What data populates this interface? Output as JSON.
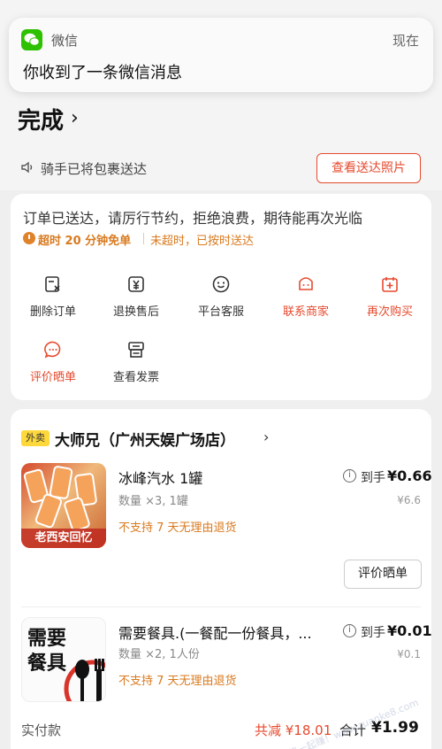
{
  "notification": {
    "app_name": "微信",
    "time": "现在",
    "message": "你收到了一条微信消息"
  },
  "status": {
    "title": "完成",
    "rider_text": "骑手已将包裹送达",
    "photo_button": "查看送达照片"
  },
  "order_info": {
    "delivered_message": "订单已送达，请厉行节约，拒绝浪费，期待能再次光临",
    "timeout_label": "超时 20 分钟免单",
    "ontime_label": "未超时，已按时送达"
  },
  "actions": [
    {
      "label": "删除订单",
      "icon": "delete-order-icon",
      "highlight": false
    },
    {
      "label": "退换售后",
      "icon": "refund-icon",
      "highlight": false
    },
    {
      "label": "平台客服",
      "icon": "customer-service-icon",
      "highlight": false
    },
    {
      "label": "联系商家",
      "icon": "store-contact-icon",
      "highlight": true
    },
    {
      "label": "再次购买",
      "icon": "rebuy-icon",
      "highlight": true
    },
    {
      "label": "评价晒单",
      "icon": "review-icon",
      "highlight": true
    },
    {
      "label": "查看发票",
      "icon": "invoice-icon",
      "highlight": false
    }
  ],
  "shop": {
    "tag": "外卖",
    "name": "大师兄（广州天娱广场店）"
  },
  "products": [
    {
      "name": "冰峰汽水 1罐",
      "qty": "数量 ×3, 1罐",
      "policy": "不支持 7 天无理由退货",
      "price_label": "到手",
      "price": "¥0.66",
      "original_price": "¥6.6",
      "image_caption": "老西安回忆",
      "review_button": "评价晒单"
    },
    {
      "name": "需要餐具.(一餐配一份餐具，...",
      "qty": "数量 ×2, 1人份",
      "policy": "不支持 7 天无理由退货",
      "price_label": "到手",
      "price": "¥0.01",
      "original_price": "¥0.1",
      "image_text": "需要\n餐具"
    }
  ],
  "summary": {
    "paid_label": "实付款",
    "discount": "共减 ¥18.01",
    "total_label": "合计",
    "total": "¥1.99"
  },
  "watermark": "赚客吧，有奖一起赚！www.zuanke8.com",
  "colors": {
    "accent": "#e64a2e",
    "orange": "#d87a1f",
    "wechat": "#2dc100"
  }
}
